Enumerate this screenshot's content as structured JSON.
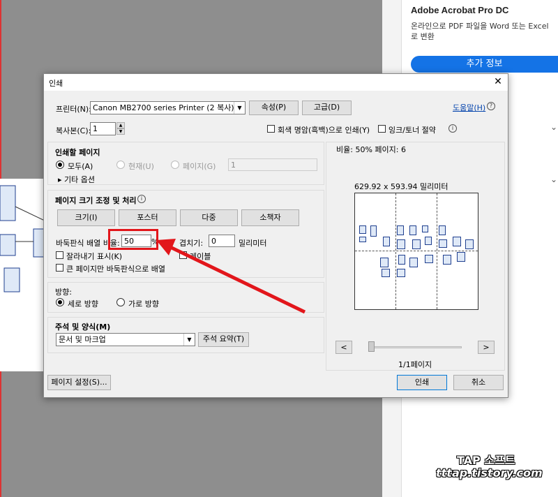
{
  "background": {
    "panel_title": "Adobe Acrobat Pro DC",
    "panel_desc": "온라인으로 PDF 파일을 Word 또는 Excel로 변환",
    "panel_button": "추가 정보"
  },
  "dialog": {
    "title": "인쇄",
    "close": "✕",
    "printer_label": "프린터(N):",
    "printer_value": "Canon MB2700 series Printer (2 복사)",
    "properties_btn": "속성(P)",
    "advanced_btn": "고급(D)",
    "help_link": "도움말(H)",
    "copies_label": "복사본(C):",
    "copies_value": "1",
    "grayscale_label": "회색 명암(흑백)으로 인쇄(Y)",
    "save_ink_label": "잉크/토너 절약",
    "pages_group": {
      "title": "인쇄할 페이지",
      "all": "모두(A)",
      "current": "현재(U)",
      "pages": "페이지(G)",
      "pages_value": "1",
      "more_options": "기타 옵션"
    },
    "sizing_group": {
      "title": "페이지 크기 조정 및 처리",
      "buttons": [
        "크기(I)",
        "포스터",
        "다중",
        "소책자"
      ],
      "tile_scale_label": "바둑판식 배열 비율:",
      "tile_scale_value": "50",
      "percent": "%",
      "overlap_label": "겹치기:",
      "overlap_value": "0",
      "overlap_unit": "밀리미터",
      "cut_marks": "잘라내기 표시(K)",
      "labels": "레이블",
      "tile_large_only": "큰 페이지만 바둑판식으로 배열"
    },
    "orientation_group": {
      "title": "방향:",
      "portrait": "세로 방향",
      "landscape": "가로 방향"
    },
    "comments_group": {
      "title": "주석 및 양식(M)",
      "select_value": "문서 및 마크업",
      "summarize_btn": "주석 요약(T)"
    },
    "preview": {
      "scale_text": "비율: 50% 페이지: 6",
      "dimensions": "629.92 x 593.94 밀리미터",
      "prev": "<",
      "next": ">",
      "page_indicator": "1/1페이지"
    },
    "page_setup_btn": "페이지 설정(S)...",
    "print_btn": "인쇄",
    "cancel_btn": "취소"
  },
  "watermark": {
    "title": "TAP 소프트",
    "site": "tttap.tistory.com"
  },
  "colors": {
    "highlight": "#e2161b",
    "acrobat_blue": "#1473e6"
  }
}
